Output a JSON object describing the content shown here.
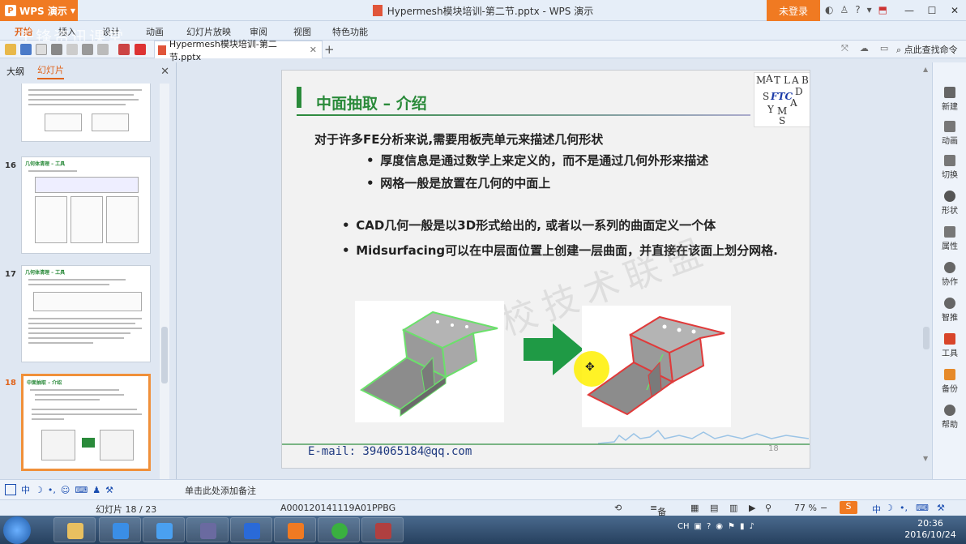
{
  "window": {
    "app_name": "WPS 演示",
    "title": "Hypermesh模块培训-第二节.pptx - WPS 演示",
    "login": "未登录"
  },
  "menu": {
    "tabs": [
      "开始",
      "插入",
      "设计",
      "动画",
      "幻灯片放映",
      "审阅",
      "视图",
      "特色功能"
    ],
    "overlay": "千锋资讯课堂"
  },
  "toolbar": {
    "doc_tab": "Hypermesh模块培训-第二节.pptx",
    "search_cmd": "点此查找命令"
  },
  "left_panel": {
    "tab_outline": "大纲",
    "tab_slides": "幻灯片",
    "thumbs": [
      {
        "num": "16",
        "title": "几何体清理 – 工具"
      },
      {
        "num": "17",
        "title": "几何体清理 – 工具"
      },
      {
        "num": "18",
        "title": "中面抽取 – 介绍"
      }
    ]
  },
  "slide": {
    "title": "中面抽取 – 介绍",
    "logo_letters": [
      "M",
      "A",
      "T",
      "L",
      "A",
      "B",
      "D",
      "A",
      "S",
      "Y",
      "M",
      "S"
    ],
    "logo_text": "FTC",
    "lead": "对于许多FE分析来说,需要用板壳单元来描述几何形状",
    "bullet1": "厚度信息是通过数学上来定义的，而不是通过几何外形来描述",
    "bullet2": "网格一般是放置在几何的中面上",
    "bullet3": "CAD几何一般是以3D形式给出的, 或者以一系列的曲面定义一个体",
    "bullet4": "Midsurfacing可以在中层面位置上创建一层曲面，并直接在该面上划分网格.",
    "watermark": "高校技术联盟",
    "email": "E-mail: 394065184@qq.com",
    "page_num": "18"
  },
  "right_bar": {
    "items": [
      "新建",
      "动画",
      "切换",
      "形状",
      "属性",
      "协作",
      "智推",
      "工具",
      "备份",
      "帮助"
    ]
  },
  "notes": {
    "placeholder": "单击此处添加备注"
  },
  "status": {
    "slide_pos": "幻灯片 18 / 23",
    "template": "A000120141119A01PPBG",
    "notes_btn": "备注",
    "zoom": "77 %"
  },
  "ime": {
    "lang": "中"
  },
  "tray": {
    "lang": "CH",
    "time": "20:36",
    "date": "2016/10/24"
  },
  "colors": {
    "accent": "#f07a22",
    "slide_green": "#2a8a3a"
  }
}
